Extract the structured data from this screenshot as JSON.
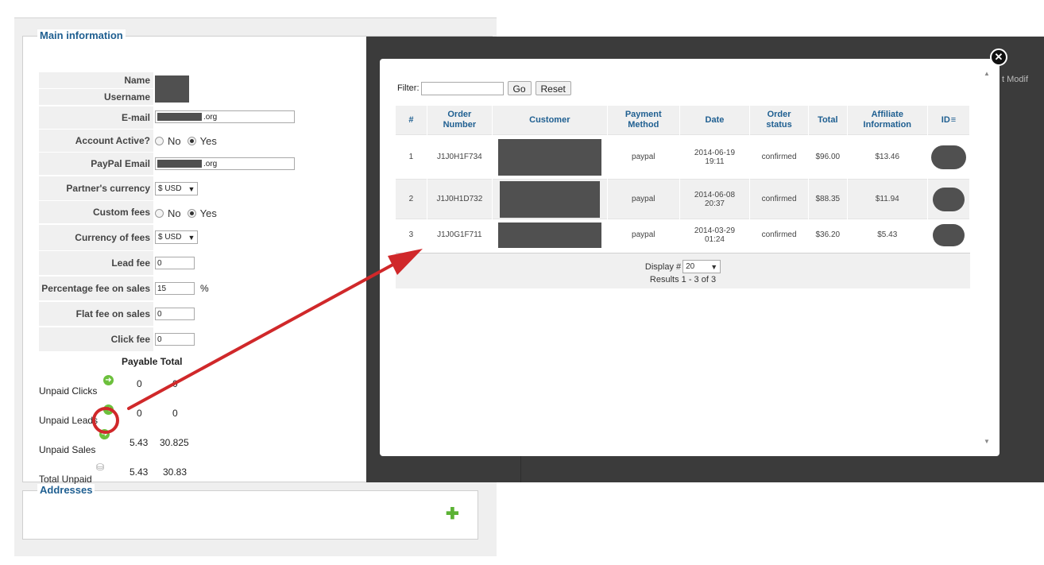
{
  "main_info": {
    "legend": "Main information",
    "labels": {
      "name": "Name",
      "username": "Username",
      "email": "E-mail",
      "account_active": "Account Active?",
      "paypal_email": "PayPal Email",
      "partner_currency": "Partner's currency",
      "custom_fees": "Custom fees",
      "currency_of_fees": "Currency of fees",
      "lead_fee": "Lead fee",
      "percentage_fee": "Percentage fee on sales",
      "flat_fee": "Flat fee on sales",
      "click_fee": "Click fee"
    },
    "email_value": ".org",
    "paypal_value": ".org",
    "radio_no": "No",
    "radio_yes": "Yes",
    "partner_currency_value": "$ USD",
    "currency_of_fees_value": "$ USD",
    "lead_fee_value": "0",
    "percentage_fee_value": "15",
    "percent_sign": "%",
    "flat_fee_value": "0",
    "click_fee_value": "0",
    "summary_header": "Payable Total",
    "summary": [
      {
        "label": "Unpaid Clicks",
        "payable": "0",
        "total": "0"
      },
      {
        "label": "Unpaid Leads",
        "payable": "0",
        "total": "0"
      },
      {
        "label": "Unpaid Sales",
        "payable": "5.43",
        "total": "30.825"
      },
      {
        "label": "Total Unpaid",
        "payable": "5.43",
        "total": "30.83"
      }
    ]
  },
  "addresses": {
    "legend": "Addresses"
  },
  "background_text": {
    "col_partial": "t Modif"
  },
  "modal": {
    "filter_label": "Filter:",
    "filter_value": "",
    "go_label": "Go",
    "reset_label": "Reset",
    "columns": [
      "#",
      "Order Number",
      "Customer",
      "Payment Method",
      "Date",
      "Order status",
      "Total",
      "Affiliate Information",
      "ID"
    ],
    "rows": [
      {
        "num": "1",
        "order": "J1J0H1F734",
        "payment": "paypal",
        "date1": "2014-06-19",
        "date2": "19:11",
        "status": "confirmed",
        "total": "$96.00",
        "affiliate": "$13.46"
      },
      {
        "num": "2",
        "order": "J1J0H1D732",
        "payment": "paypal",
        "date1": "2014-06-08",
        "date2": "20:37",
        "status": "confirmed",
        "total": "$88.35",
        "affiliate": "$11.94"
      },
      {
        "num": "3",
        "order": "J1J0G1F711",
        "payment": "paypal",
        "date1": "2014-03-29",
        "date2": "01:24",
        "status": "confirmed",
        "total": "$36.20",
        "affiliate": "$5.43"
      }
    ],
    "display_label": "Display #",
    "display_value": "20",
    "results_text": "Results 1 - 3 of 3"
  },
  "colors": {
    "accent": "#1f5f91",
    "annotation": "#d0282a",
    "go_icon": "#6cc03c",
    "overlay": "#3b3b3b"
  }
}
